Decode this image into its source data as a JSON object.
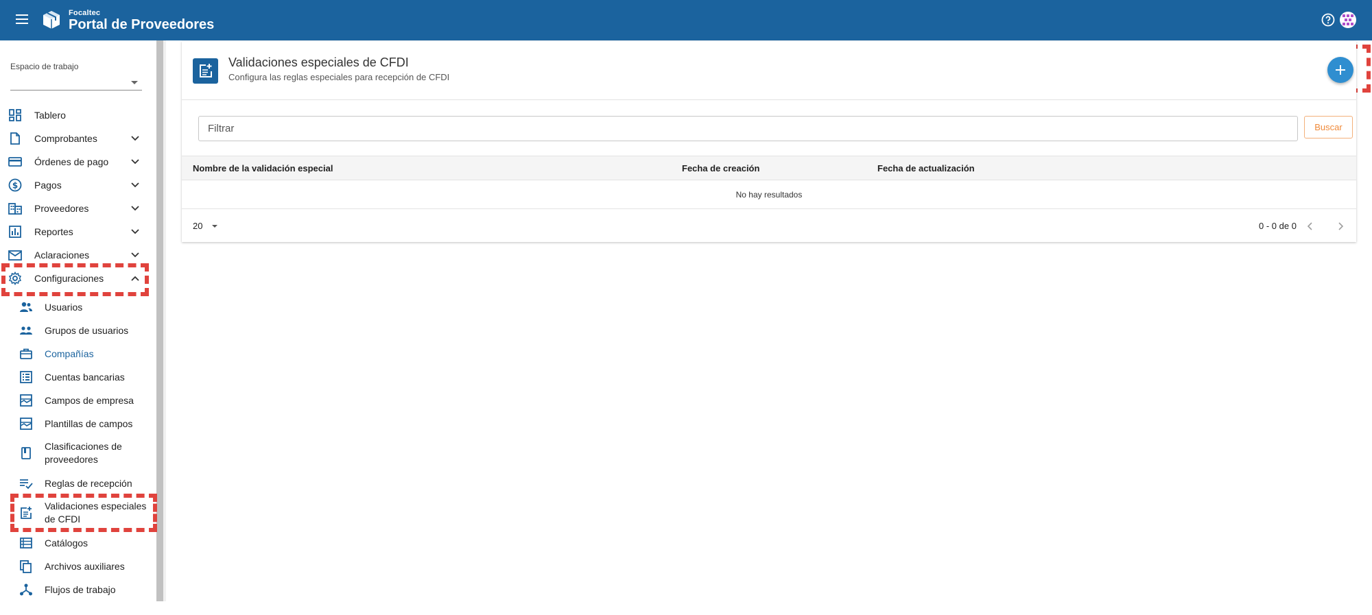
{
  "app": {
    "brand_small": "Focaltec",
    "brand_name": "Portal de Proveedores"
  },
  "sidebar": {
    "workspace_label": "Espacio de trabajo",
    "items": [
      {
        "label": "Tablero"
      },
      {
        "label": "Comprobantes"
      },
      {
        "label": "Órdenes de pago"
      },
      {
        "label": "Pagos"
      },
      {
        "label": "Proveedores"
      },
      {
        "label": "Reportes"
      },
      {
        "label": "Aclaraciones"
      },
      {
        "label": "Configuraciones"
      }
    ],
    "sub_items": [
      {
        "label": "Usuarios"
      },
      {
        "label": "Grupos de usuarios"
      },
      {
        "label": "Compañías"
      },
      {
        "label": "Cuentas bancarias"
      },
      {
        "label": "Campos de empresa"
      },
      {
        "label": "Plantillas de campos"
      },
      {
        "label": "Clasificaciones de proveedores"
      },
      {
        "label": "Reglas de recepción"
      },
      {
        "label": "Validaciones especiales de CFDI"
      },
      {
        "label": "Catálogos"
      },
      {
        "label": "Archivos auxiliares"
      },
      {
        "label": "Flujos de trabajo"
      }
    ]
  },
  "main": {
    "title": "Validaciones especiales de CFDI",
    "subtitle": "Configura las reglas especiales para recepción de CFDI",
    "filter_placeholder": "Filtrar",
    "search_label": "Buscar",
    "columns": [
      "Nombre de la validación especial",
      "Fecha de creación",
      "Fecha de actualización"
    ],
    "empty_message": "No hay resultados",
    "page_size": "20",
    "range": "0 - 0 de 0"
  },
  "colors": {
    "primary": "#1b639e",
    "fab": "#2f8ed0",
    "highlight": "#e0433d",
    "search_accent": "#f08a3a"
  }
}
